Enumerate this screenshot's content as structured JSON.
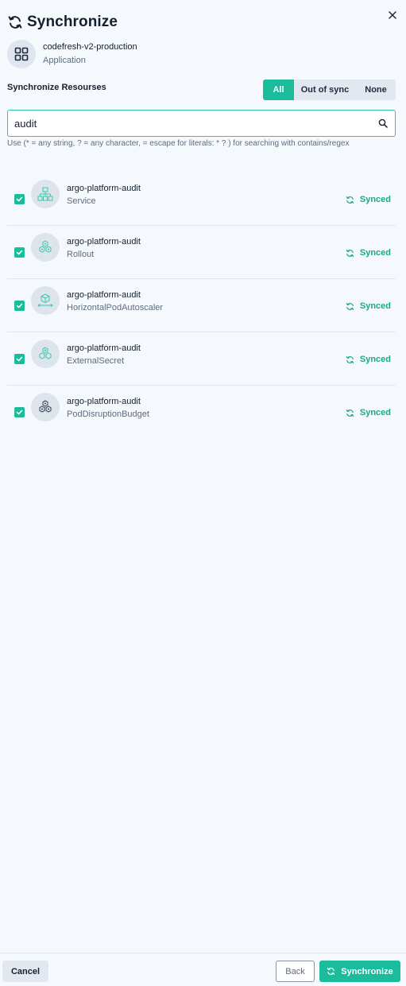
{
  "header": {
    "title": "Synchronize"
  },
  "application": {
    "name": "codefresh-v2-production",
    "type": "Application"
  },
  "resources_section": {
    "label": "Synchronize Resourses",
    "filters": [
      {
        "label": "All",
        "active": true
      },
      {
        "label": "Out of sync",
        "active": false
      },
      {
        "label": "None",
        "active": false
      }
    ]
  },
  "search": {
    "value": "audit",
    "hint": "Use (* = any string, ? = any character, = escape for literals: * ? ) for searching with contains/regex"
  },
  "resources": [
    {
      "name": "argo-platform-audit",
      "kind": "Service",
      "status": "Synced",
      "checked": true,
      "icon": "service-icon"
    },
    {
      "name": "argo-platform-audit",
      "kind": "Rollout",
      "status": "Synced",
      "checked": true,
      "icon": "rollout-icon"
    },
    {
      "name": "argo-platform-audit",
      "kind": "HorizontalPodAutoscaler",
      "status": "Synced",
      "checked": true,
      "icon": "hpa-icon"
    },
    {
      "name": "argo-platform-audit",
      "kind": "ExternalSecret",
      "status": "Synced",
      "checked": true,
      "icon": "external-secret-icon"
    },
    {
      "name": "argo-platform-audit",
      "kind": "PodDisruptionBudget",
      "status": "Synced",
      "checked": true,
      "icon": "pdb-icon"
    }
  ],
  "footer": {
    "cancel_label": "Cancel",
    "back_label": "Back",
    "synchronize_label": "Synchronize"
  },
  "colors": {
    "accent": "#1abc9c",
    "synced": "#1aa88a",
    "background": "#f5f8fc"
  }
}
